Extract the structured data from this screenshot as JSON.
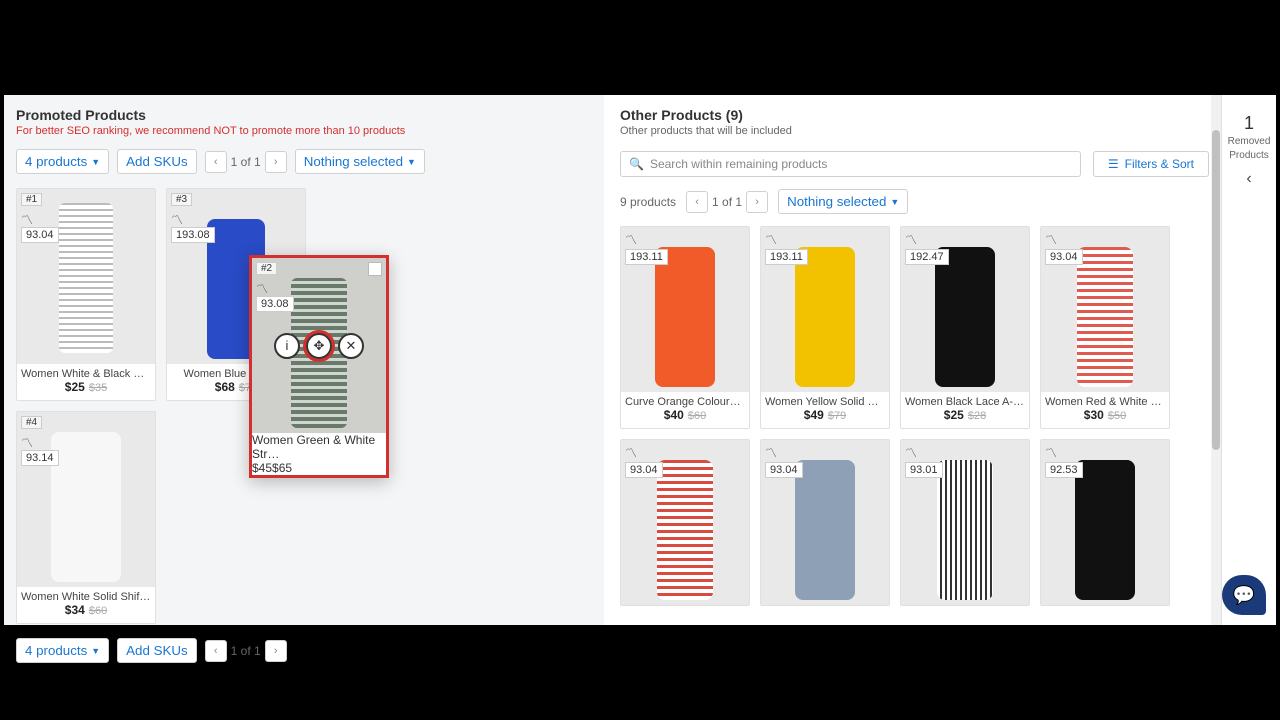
{
  "left": {
    "title": "Promoted Products",
    "warn": "For better SEO ranking, we recommend NOT to promote more than 10 products",
    "products_btn": "4 products",
    "add_skus": "Add SKUs",
    "page_label": "1 of 1",
    "nothing_selected": "Nothing selected",
    "cards": [
      {
        "rank": "#1",
        "score": "93.04",
        "title": "Women White & Black Stri…",
        "price": "$25",
        "old": "$35"
      },
      {
        "rank": "#3",
        "score": "193.08",
        "title": "Women Blue Self-s…",
        "price": "$68",
        "old": "$78"
      },
      {
        "rank": "#4",
        "score": "93.14",
        "title": "Women White Solid Shift …",
        "price": "$34",
        "old": "$60"
      }
    ],
    "drag": {
      "rank": "#2",
      "score": "93.08",
      "title": "Women Green & White Str…",
      "price": "$45",
      "old": "$65"
    }
  },
  "right": {
    "title": "Other Products (9)",
    "sub": "Other products that will be included",
    "search_placeholder": "Search within remaining products",
    "filters_btn": "Filters & Sort",
    "products_count": "9 products",
    "page_label": "1 of 1",
    "nothing_selected": "Nothing selected",
    "row1": [
      {
        "score": "193.11",
        "title": "Curve Orange Coloured S…",
        "price": "$40",
        "old": "$60"
      },
      {
        "score": "193.11",
        "title": "Women Yellow Solid Midi…",
        "price": "$49",
        "old": "$79"
      },
      {
        "score": "192.47",
        "title": "Women Black Lace A-Lin…",
        "price": "$25",
        "old": "$28"
      },
      {
        "score": "93.04",
        "title": "Women Red & White Stri…",
        "price": "$30",
        "old": "$50"
      }
    ],
    "row2": [
      {
        "score": "93.04"
      },
      {
        "score": "93.04"
      },
      {
        "score": "93.01"
      },
      {
        "score": "92.53"
      }
    ]
  },
  "removed": {
    "count": "1",
    "label1": "Removed",
    "label2": "Products"
  }
}
